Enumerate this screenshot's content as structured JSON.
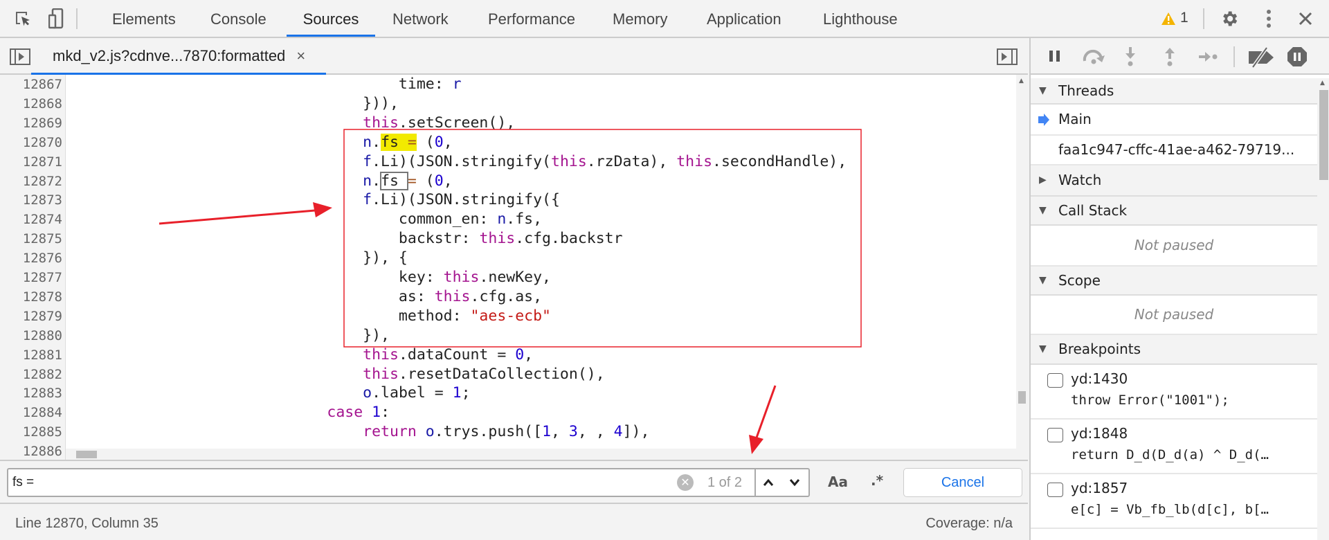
{
  "tabs": [
    "Elements",
    "Console",
    "Sources",
    "Network",
    "Performance",
    "Memory",
    "Application",
    "Lighthouse"
  ],
  "active_tab": "Sources",
  "warnings_count": "1",
  "file_tab": {
    "label": "mkd_v2.js?cdnve...7870:formatted",
    "close": "×"
  },
  "code_lines": [
    {
      "num": "12867",
      "tokens": [
        [
          "",
          "                                     time: "
        ],
        [
          "var",
          "r"
        ]
      ]
    },
    {
      "num": "12868",
      "tokens": [
        [
          "",
          "                                 })),"
        ]
      ]
    },
    {
      "num": "12869",
      "tokens": [
        [
          "",
          "                                 "
        ],
        [
          "kw",
          "this"
        ],
        [
          "",
          ".setScreen(),"
        ]
      ]
    },
    {
      "num": "12870",
      "tokens": [
        [
          "",
          "                                 "
        ],
        [
          "var",
          "n"
        ],
        [
          "",
          "."
        ],
        [
          "hl",
          "fs "
        ],
        [
          "hl op",
          "="
        ],
        [
          "",
          " ("
        ],
        [
          "num",
          "0"
        ],
        [
          "",
          ","
        ]
      ]
    },
    {
      "num": "12871",
      "tokens": [
        [
          "",
          "                                 "
        ],
        [
          "var",
          "f"
        ],
        [
          "",
          ".Li)(JSON.stringify("
        ],
        [
          "kw",
          "this"
        ],
        [
          "",
          ".rzData), "
        ],
        [
          "kw",
          "this"
        ],
        [
          "",
          ".secondHandle),"
        ]
      ]
    },
    {
      "num": "12872",
      "tokens": [
        [
          "",
          "                                 "
        ],
        [
          "var",
          "n"
        ],
        [
          "",
          "."
        ],
        [
          "box",
          "fs "
        ],
        [
          "op",
          "="
        ],
        [
          "",
          " ("
        ],
        [
          "num",
          "0"
        ],
        [
          "",
          ","
        ]
      ]
    },
    {
      "num": "12873",
      "tokens": [
        [
          "",
          "                                 "
        ],
        [
          "var",
          "f"
        ],
        [
          "",
          ".Li)(JSON.stringify({"
        ]
      ]
    },
    {
      "num": "12874",
      "tokens": [
        [
          "",
          "                                     common_en: "
        ],
        [
          "var",
          "n"
        ],
        [
          "",
          ".fs,"
        ]
      ]
    },
    {
      "num": "12875",
      "tokens": [
        [
          "",
          "                                     backstr: "
        ],
        [
          "kw",
          "this"
        ],
        [
          "",
          ".cfg.backstr"
        ]
      ]
    },
    {
      "num": "12876",
      "tokens": [
        [
          "",
          "                                 }), {"
        ]
      ]
    },
    {
      "num": "12877",
      "tokens": [
        [
          "",
          "                                     key: "
        ],
        [
          "kw",
          "this"
        ],
        [
          "",
          ".newKey,"
        ]
      ]
    },
    {
      "num": "12878",
      "tokens": [
        [
          "",
          "                                     as: "
        ],
        [
          "kw",
          "this"
        ],
        [
          "",
          ".cfg.as,"
        ]
      ]
    },
    {
      "num": "12879",
      "tokens": [
        [
          "",
          "                                     method: "
        ],
        [
          "str",
          "\"aes-ecb\""
        ]
      ]
    },
    {
      "num": "12880",
      "tokens": [
        [
          "",
          "                                 }),"
        ]
      ]
    },
    {
      "num": "12881",
      "tokens": [
        [
          "",
          "                                 "
        ],
        [
          "kw",
          "this"
        ],
        [
          "",
          ".dataCount = "
        ],
        [
          "num",
          "0"
        ],
        [
          "",
          ","
        ]
      ]
    },
    {
      "num": "12882",
      "tokens": [
        [
          "",
          "                                 "
        ],
        [
          "kw",
          "this"
        ],
        [
          "",
          ".resetDataCollection(),"
        ]
      ]
    },
    {
      "num": "12883",
      "tokens": [
        [
          "",
          "                                 "
        ],
        [
          "var",
          "o"
        ],
        [
          "",
          ".label = "
        ],
        [
          "num",
          "1"
        ],
        [
          "",
          ";"
        ]
      ]
    },
    {
      "num": "12884",
      "tokens": [
        [
          "",
          "                             "
        ],
        [
          "kw",
          "case"
        ],
        [
          "",
          ""
        ],
        [
          "num",
          " 1"
        ],
        [
          "",
          ":"
        ]
      ]
    },
    {
      "num": "12885",
      "tokens": [
        [
          "",
          "                                 "
        ],
        [
          "kw",
          "return"
        ],
        [
          "",
          " "
        ],
        [
          "var",
          "o"
        ],
        [
          "",
          ".trys.push(["
        ],
        [
          "num",
          "1"
        ],
        [
          "",
          ", "
        ],
        [
          "num",
          "3"
        ],
        [
          "",
          ", , "
        ],
        [
          "num",
          "4"
        ],
        [
          "",
          "]),"
        ]
      ]
    },
    {
      "num": "12886",
      "tokens": []
    }
  ],
  "search": {
    "value": "fs =",
    "match_count": "1 of 2",
    "case_label": "Aa",
    "regex_label": ".*",
    "cancel": "Cancel"
  },
  "status": {
    "position": "Line 12870, Column 35",
    "coverage": "Coverage: n/a"
  },
  "sidebar": {
    "threads": {
      "title": "Threads",
      "main": "Main",
      "worker": "faa1c947-cffc-41ae-a462-79719..."
    },
    "watch": "Watch",
    "call_stack": {
      "title": "Call Stack",
      "empty": "Not paused"
    },
    "scope": {
      "title": "Scope",
      "empty": "Not paused"
    },
    "breakpoints": {
      "title": "Breakpoints",
      "items": [
        {
          "location": "yd:1430",
          "code": "throw Error(\"1001\");",
          "checked": false
        },
        {
          "location": "yd:1848",
          "code": "return D_d(D_d(a) ^ D_d(…",
          "checked": false
        },
        {
          "location": "yd:1857",
          "code": "e[c] = Vb_fb_lb(d[c], b[…",
          "checked": false
        }
      ]
    }
  },
  "colors": {
    "accent": "#1a73e8",
    "annotation": "#e8202a",
    "warning": "#f4b400",
    "search_highlight": "#f2ea00"
  }
}
